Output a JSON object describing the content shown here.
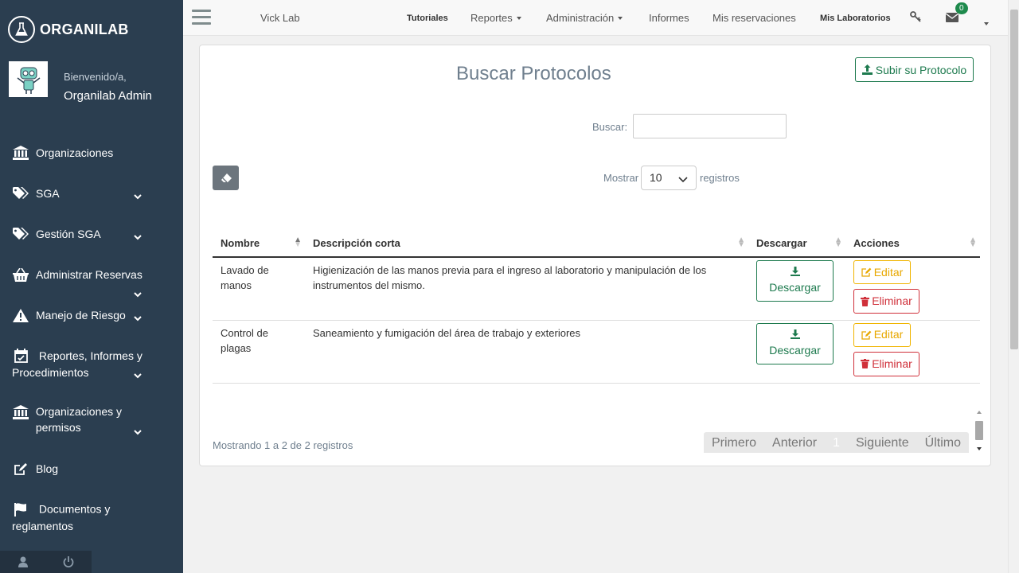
{
  "brand": {
    "name": "ORGANILAB"
  },
  "user": {
    "welcome": "Bienvenido/a,",
    "name": "Organilab Admin"
  },
  "sidebar": {
    "items": [
      {
        "label": "Organizaciones"
      },
      {
        "label": "SGA"
      },
      {
        "label": "Gestión SGA"
      },
      {
        "label": "Administrar Reservas"
      },
      {
        "label": "Manejo de Riesgo"
      },
      {
        "label": "Reportes, Informes y Procedimientos"
      },
      {
        "label": "Organizaciones y permisos"
      },
      {
        "label": "Blog"
      },
      {
        "label": "Documentos y reglamentos"
      }
    ]
  },
  "topbar": {
    "lab": "Vick Lab",
    "tutoriales": "Tutoriales",
    "reportes": "Reportes",
    "administracion": "Administración",
    "informes": "Informes",
    "reservaciones": "Mis reservaciones",
    "laboratorios": "Mis Laboratorios",
    "messages_count": "0"
  },
  "page": {
    "title": "Buscar Protocolos",
    "upload_label": "Subir su Protocolo",
    "search_label": "Buscar:",
    "search_value": "",
    "show_label": "Mostrar",
    "show_value": "10",
    "records_label": "registros"
  },
  "table": {
    "headers": [
      "Nombre",
      "Descripción corta",
      "Descargar",
      "Acciones"
    ],
    "rows": [
      {
        "name": "Lavado de manos",
        "desc": "Higienización de las manos previa para el ingreso al laboratorio y manipulación de los instrumentos del mismo.",
        "download": "Descargar",
        "edit": "Editar",
        "delete": "Eliminar"
      },
      {
        "name": "Control de plagas",
        "desc": "Saneamiento y fumigación del área de trabajo y exteriores",
        "download": "Descargar",
        "edit": "Editar",
        "delete": "Eliminar"
      }
    ]
  },
  "footer": {
    "info": "Mostrando 1 a 2 de 2 registros",
    "pager": {
      "first": "Primero",
      "prev": "Anterior",
      "current": "1",
      "next": "Siguiente",
      "last": "Último"
    }
  },
  "colors": {
    "sidebar": "#2b3e50",
    "success": "#1d7a4e",
    "warning": "#f0b400",
    "danger": "#d0303a"
  },
  "icons": [
    "flask-icon",
    "hamburger-icon",
    "key-icon",
    "envelope-icon",
    "bank-icon",
    "tags-icon",
    "basket-icon",
    "warning-icon",
    "calendar-check-icon",
    "edit-icon",
    "flag-icon",
    "user-icon",
    "power-icon",
    "upload-icon",
    "eraser-icon",
    "download-icon",
    "trash-icon"
  ]
}
